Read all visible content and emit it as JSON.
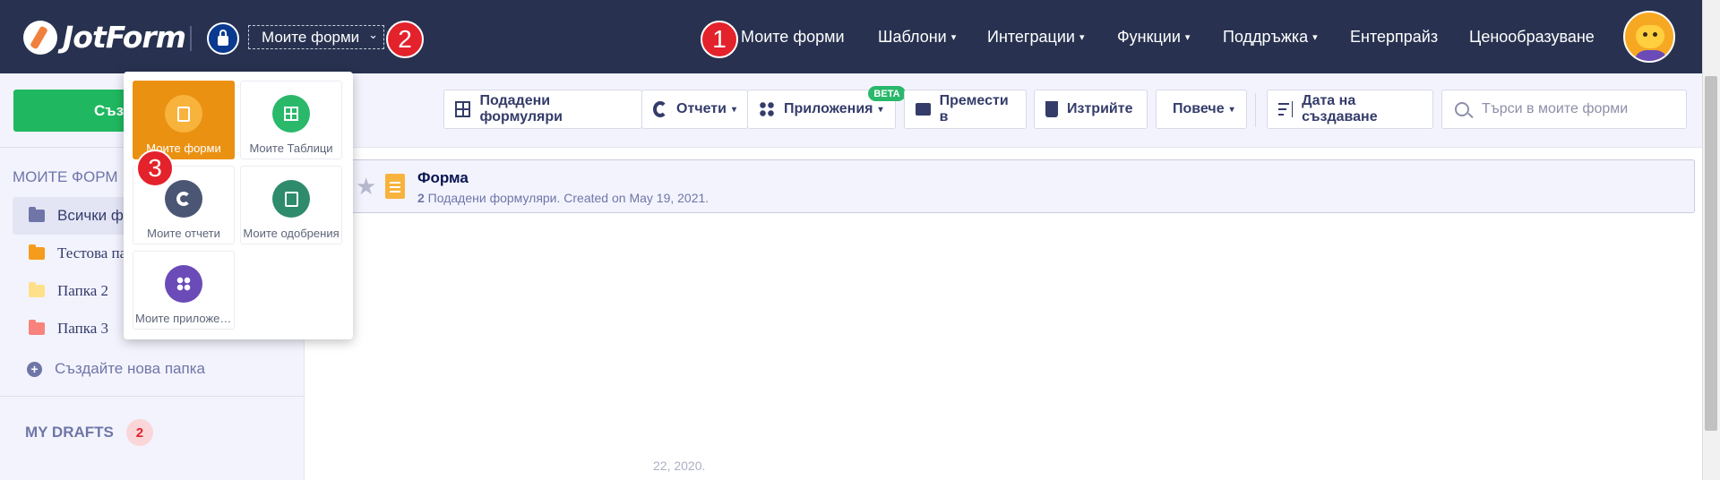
{
  "topbar": {
    "logo_text": "JotForm",
    "form_select_value": "Моите форми",
    "nav_items": [
      {
        "label": "Моите форми",
        "has_caret": false
      },
      {
        "label": "Шаблони",
        "has_caret": true
      },
      {
        "label": "Интеграции",
        "has_caret": true
      },
      {
        "label": "Функции",
        "has_caret": true
      },
      {
        "label": "Поддръжка",
        "has_caret": true
      },
      {
        "label": "Ентерпрайз",
        "has_caret": false
      },
      {
        "label": "Ценообразуване",
        "has_caret": false
      }
    ],
    "caret_glyph": "▾",
    "select_chevron": "⌄"
  },
  "steps": {
    "one": "1",
    "two": "2",
    "three": "3"
  },
  "sidebar": {
    "create_label": "Създ",
    "section_title": "МОИТЕ ФОРМ",
    "folders": [
      {
        "label": "Всички ф",
        "color": "#6f76a7"
      },
      {
        "label": "Тестова па",
        "color": "#f59b1d"
      },
      {
        "label": "Папка 2",
        "color": "#ffe08a"
      },
      {
        "label": "Папка 3",
        "color": "#f7837c"
      }
    ],
    "new_folder_label": "Създайте нова папка",
    "drafts_label": "MY DRAFTS",
    "drafts_count": "2"
  },
  "toolbar": {
    "submissions_label": "Подадени формуляри",
    "reports_label": "Отчети",
    "apps_label": "Приложения",
    "beta_label": "BETA",
    "move_label": "Премести в",
    "delete_label": "Изтрийте",
    "more_label": "Повече",
    "sort_label": "Дата на създаване",
    "search_placeholder": "Търси в моите форми"
  },
  "form_list": [
    {
      "title": "Форма",
      "count": "2",
      "subtitle_rest": " Подадени формуляри. Created on May 19, 2021."
    }
  ],
  "faint_text": "22, 2020.",
  "popup": {
    "tiles": [
      {
        "label": "Моите форми",
        "color": "#f8b33d",
        "icon": "doc-icon",
        "active": true
      },
      {
        "label": "Моите Таблици",
        "color": "#2ab86a",
        "icon": "table-icon",
        "active": false
      },
      {
        "label": "Моите отчети",
        "color": "#4b5674",
        "icon": "report-icon",
        "active": false
      },
      {
        "label": "Моите одобрения",
        "color": "#2e8b6b",
        "icon": "approval-icon",
        "active": false
      },
      {
        "label": "Моите приложения",
        "color": "#6b4bb8",
        "icon": "apps-icon",
        "active": false
      }
    ]
  },
  "colors": {
    "accent": "#283250",
    "brand_orange": "#ea9112",
    "step_red": "#e3222b",
    "create_green": "#1fb860"
  }
}
